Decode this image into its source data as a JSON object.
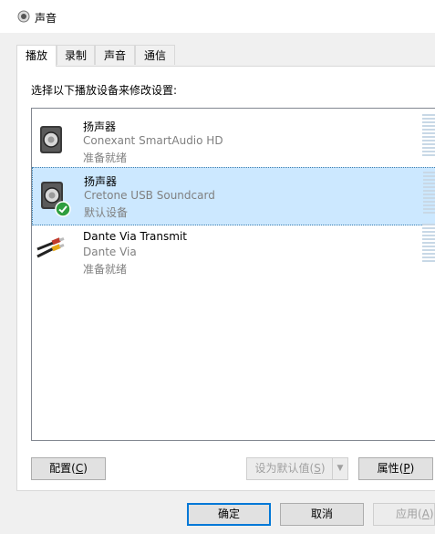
{
  "window": {
    "title": "声音",
    "icon": "speaker-icon"
  },
  "tabs": [
    {
      "label": "播放",
      "active": true
    },
    {
      "label": "录制",
      "active": false
    },
    {
      "label": "声音",
      "active": false
    },
    {
      "label": "通信",
      "active": false
    }
  ],
  "instruction": "选择以下播放设备来修改设置:",
  "devices": [
    {
      "name": "扬声器",
      "description": "Conexant SmartAudio HD",
      "status": "准备就绪",
      "icon": "speaker-device-icon",
      "selected": false,
      "is_default": false
    },
    {
      "name": "扬声器",
      "description": "Cretone USB Soundcard",
      "status": "默认设备",
      "icon": "speaker-device-icon",
      "selected": true,
      "is_default": true
    },
    {
      "name": "Dante Via Transmit",
      "description": "Dante Via",
      "status": "准备就绪",
      "icon": "audio-cable-icon",
      "selected": false,
      "is_default": false
    }
  ],
  "buttons": {
    "configure": {
      "label": "配置",
      "accel": "C"
    },
    "set_default": {
      "label": "设为默认值",
      "accel": "S"
    },
    "properties": {
      "label": "属性",
      "accel": "P"
    },
    "ok": {
      "label": "确定"
    },
    "cancel": {
      "label": "取消"
    },
    "apply": {
      "label": "应用",
      "accel": "A"
    }
  },
  "colors": {
    "selection": "#cce8ff",
    "accent": "#0078d7",
    "default_badge": "#2e9e3e"
  }
}
